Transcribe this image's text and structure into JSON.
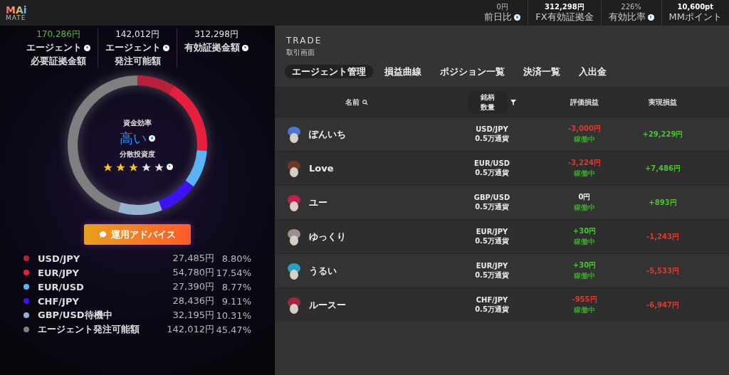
{
  "header": {
    "logo_top": "MAi",
    "logo_bottom": "MATE",
    "stats": [
      {
        "value": "0円",
        "label": "前日比",
        "help": true,
        "bold": false
      },
      {
        "value": "312,298円",
        "label": "FX有効証拠金",
        "help": false,
        "bold": true
      },
      {
        "value": "226%",
        "label": "有効比率",
        "help": true,
        "bold": false
      },
      {
        "value": "10,600pt",
        "label": "MMポイント",
        "help": false,
        "bold": true
      }
    ]
  },
  "summary": [
    {
      "value": "170,286円",
      "label": "エージェント",
      "sublabel": "必要証拠金額",
      "help": true,
      "highlighted": true
    },
    {
      "value": "142,012円",
      "label": "エージェント",
      "sublabel": "発注可能額",
      "help": true,
      "highlighted": false
    },
    {
      "value": "312,298円",
      "label": "有効証拠金額",
      "help": true,
      "highlighted": false
    }
  ],
  "gauge": {
    "efficiency_label": "資金効率",
    "efficiency_value": "高い",
    "diversity_label": "分散投資度",
    "stars": 3,
    "chart_data": {
      "type": "donut",
      "values": [
        8.8,
        17.54,
        8.77,
        9.11,
        10.31,
        45.47
      ]
    }
  },
  "advice_button": "運用アドバイス",
  "legend": [
    {
      "name": "USD/JPY",
      "amount": "27,485円",
      "share": "8.80%",
      "color": "#b8203a"
    },
    {
      "name": "EUR/JPY",
      "amount": "54,780円",
      "share": "17.54%",
      "color": "#e81f3c"
    },
    {
      "name": "EUR/USD",
      "amount": "27,390円",
      "share": "8.77%",
      "color": "#5ab4f4"
    },
    {
      "name": "CHF/JPY",
      "amount": "28,436円",
      "share": "9.11%",
      "color": "#3d12f5"
    },
    {
      "name": "GBP/USD待機中",
      "amount": "32,195円",
      "share": "10.31%",
      "color": "#93b3cf"
    },
    {
      "name": "エージェント発注可能額",
      "amount": "142,012円",
      "share": "45.47%",
      "color": "#7f7f7f"
    }
  ],
  "trade": {
    "title": "TRADE",
    "subtitle": "取引画面",
    "tabs": [
      {
        "label": "エージェント管理",
        "selected": true
      },
      {
        "label": "損益曲線",
        "selected": false
      },
      {
        "label": "ポジション一覧",
        "selected": false
      },
      {
        "label": "決済一覧",
        "selected": false
      },
      {
        "label": "入出金",
        "selected": false
      }
    ],
    "columns": {
      "name": "名前",
      "pair": "銘柄",
      "quantity": "数量",
      "unrealized": "評価損益",
      "realized": "実現損益"
    },
    "rows": [
      {
        "name": "ぽんいち",
        "pair": "USD/JPY",
        "quantity": "0.5万通貨",
        "unrealized": {
          "text": "-3,000円",
          "kind": "loss"
        },
        "status": "稼働中",
        "realized": {
          "text": "+29,229円",
          "kind": "gain"
        }
      },
      {
        "name": "Love",
        "pair": "EUR/USD",
        "quantity": "0.5万通貨",
        "unrealized": {
          "text": "-3,224円",
          "kind": "loss"
        },
        "status": "稼働中",
        "realized": {
          "text": "+7,486円",
          "kind": "gain"
        }
      },
      {
        "name": "ユー",
        "pair": "GBP/USD",
        "quantity": "0.5万通貨",
        "unrealized": {
          "text": "0円",
          "kind": "neutral"
        },
        "status": "稼働中",
        "realized": {
          "text": "+893円",
          "kind": "gain"
        }
      },
      {
        "name": "ゆっくり",
        "pair": "EUR/JPY",
        "quantity": "0.5万通貨",
        "unrealized": {
          "text": "+30円",
          "kind": "gain"
        },
        "status": "稼働中",
        "realized": {
          "text": "-1,243円",
          "kind": "loss"
        }
      },
      {
        "name": "うるい",
        "pair": "EUR/JPY",
        "quantity": "0.5万通貨",
        "unrealized": {
          "text": "+30円",
          "kind": "gain"
        },
        "status": "稼働中",
        "realized": {
          "text": "-5,533円",
          "kind": "loss"
        }
      },
      {
        "name": "ルースー",
        "pair": "CHF/JPY",
        "quantity": "0.5万通貨",
        "unrealized": {
          "text": "-955円",
          "kind": "loss"
        },
        "status": "稼働中",
        "realized": {
          "text": "-6,947円",
          "kind": "loss"
        }
      }
    ]
  }
}
